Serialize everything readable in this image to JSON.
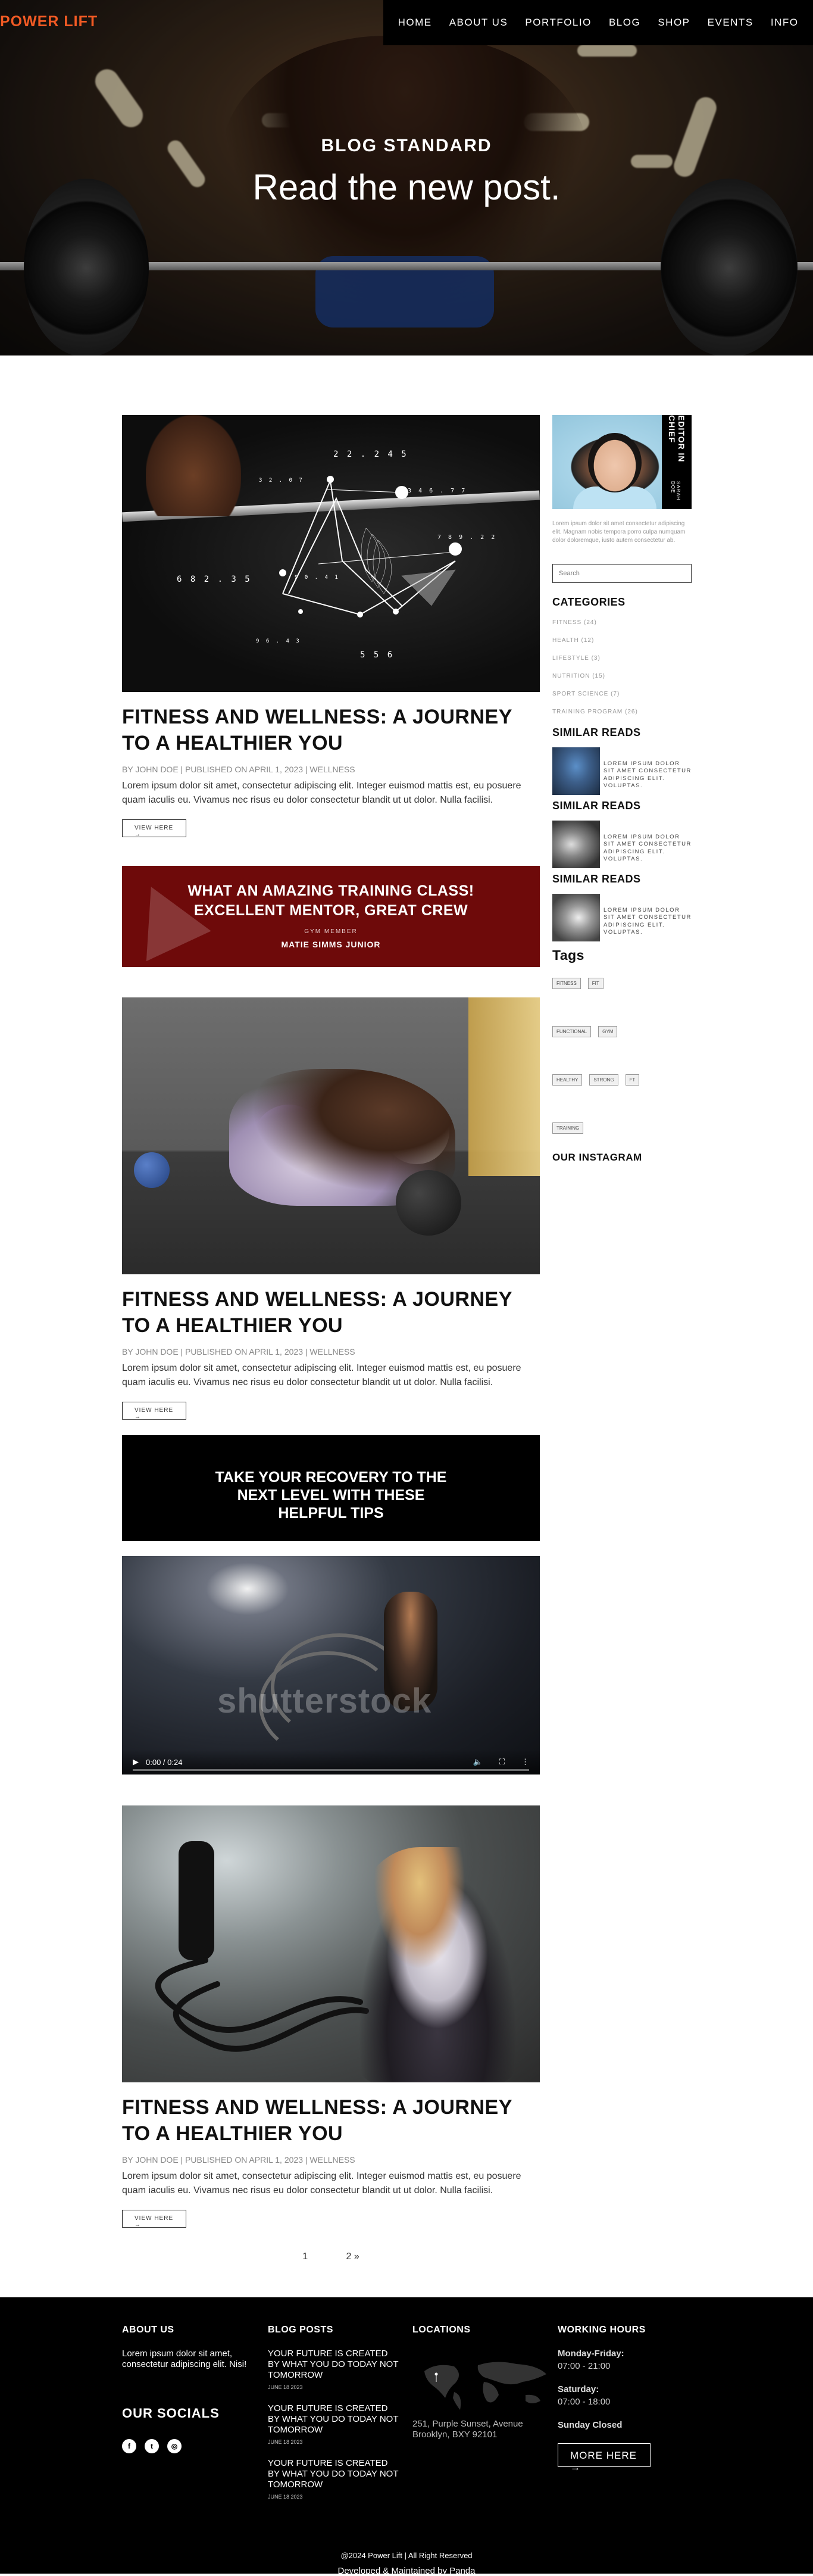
{
  "brand": {
    "logo": "POWER LIFT",
    "accent": "#f15a24"
  },
  "nav": [
    "HOME",
    "ABOUT US",
    "PORTFOLIO",
    "BLOG",
    "SHOP",
    "EVENTS",
    "INFO"
  ],
  "hero": {
    "subtitle": "BLOG STANDARD",
    "title": "Read the new post."
  },
  "posts": [
    {
      "title": "FITNESS AND WELLNESS: A JOURNEY TO A HEALTHIER YOU",
      "meta": "BY JOHN DOE | PUBLISHED ON APRIL 1, 2023 | WELLNESS",
      "excerpt": "Lorem ipsum dolor sit amet, consectetur adipiscing elit. Integer euismod mattis est, eu posuere quam iaculis eu. Vivamus nec risus eu dolor consectetur blandit ut ut dolor. Nulla facilisi.",
      "button": "VIEW HERE →",
      "image_labels": [
        "2 2 . 2 4 5",
        "3 4 6 . 7 7",
        "7 8 9 . 2 2",
        "6 8 2 . 3 5",
        "9 0 . 4 1",
        "3 2 . 0 7",
        "9 6 . 4 3",
        "5 5 6"
      ]
    },
    {
      "title": "FITNESS AND WELLNESS: A JOURNEY TO A HEALTHIER YOU",
      "meta": "BY JOHN DOE | PUBLISHED ON APRIL 1, 2023 | WELLNESS",
      "excerpt": "Lorem ipsum dolor sit amet, consectetur adipiscing elit. Integer euismod mattis est, eu posuere quam iaculis eu. Vivamus nec risus eu dolor consectetur blandit ut ut dolor. Nulla facilisi.",
      "button": "VIEW HERE →"
    },
    {
      "title": "FITNESS AND WELLNESS: A JOURNEY TO A HEALTHIER YOU",
      "meta": "BY JOHN DOE | PUBLISHED ON APRIL 1, 2023 | WELLNESS",
      "excerpt": "Lorem ipsum dolor sit amet, consectetur adipiscing elit. Integer euismod mattis est, eu posuere quam iaculis eu. Vivamus nec risus eu dolor consectetur blandit ut ut dolor. Nulla facilisi.",
      "button": "VIEW HERE →"
    }
  ],
  "promo": {
    "headline": "WHAT AN AMAZING TRAINING CLASS! EXCELLENT MENTOR, GREAT CREW",
    "role": "GYM MEMBER",
    "name": "MATIE SIMMS JUNIOR",
    "color": "#6e0a0a"
  },
  "banner": {
    "text": "TAKE YOUR RECOVERY TO THE NEXT LEVEL WITH THESE HELPFUL TIPS"
  },
  "video": {
    "time": "0:00 / 0:24",
    "watermark": "shutterstock"
  },
  "pagination": {
    "page1": "1",
    "page2": "2 »"
  },
  "sidebar": {
    "editor_label": "EDITOR IN CHIEF",
    "editor_role": "SARAH DOE",
    "bio": "Lorem ipsum dolor sit amet consectetur adipiscing elit. Magnam nobis tempora porro culpa numquam dolor doloremque, iusto autem consectetur ab.",
    "search_placeholder": "Search",
    "categories_title": "CATEGORIES",
    "categories": [
      "FITNESS (24)",
      "HEALTH (12)",
      "LIFESTYLE (3)",
      "NUTRITION (15)",
      "SPORT SCIENCE (7)",
      "TRAINING PROGRAM (26)"
    ],
    "similar_title": "SIMILAR READS",
    "similar_text": "LOREM IPSUM DOLOR SIT AMET CONSECTETUR ADIPISCING ELIT. VOLUPTAS.",
    "tags_title": "Tags",
    "tags": [
      "FITNESS",
      "FIT",
      "FUNCTIONAL",
      "GYM",
      "HEALTHY",
      "STRONG",
      "FT",
      "TRAINING"
    ],
    "instagram_title": "OUR INSTAGRAM"
  },
  "footer": {
    "about_title": "ABOUT US",
    "about_text": "Lorem ipsum dolor sit amet, consectetur adipiscing elit. Nisi!",
    "social_title": "OUR SOCIALS",
    "social_icons": [
      "facebook-icon",
      "twitter-icon",
      "instagram-icon"
    ],
    "blog_title": "BLOG POSTS",
    "blog_posts": [
      {
        "title": "YOUR FUTURE IS CREATED BY WHAT YOU DO TODAY NOT TOMORROW",
        "date": "JUNE 18 2023"
      },
      {
        "title": "YOUR FUTURE IS CREATED BY WHAT YOU DO TODAY NOT TOMORROW",
        "date": "JUNE 18 2023"
      },
      {
        "title": "YOUR FUTURE IS CREATED BY WHAT YOU DO TODAY NOT TOMORROW",
        "date": "JUNE 18 2023"
      }
    ],
    "locations_title": "LOCATIONS",
    "address": "251, Purple Sunset, Avenue Brooklyn, BXY 92101",
    "hours_title": "WORKING HOURS",
    "weekday_label": "Monday-Friday:",
    "weekday_hours": "07:00 - 21:00",
    "saturday_label": "Saturday:",
    "saturday_hours": "07:00 - 18:00",
    "sunday": "Sunday Closed",
    "more_button": "MORE HERE →"
  },
  "copyright": {
    "line1": "@2024 Power Lift | All Right Reserved",
    "line2": "Developed & Maintained by Panda"
  }
}
